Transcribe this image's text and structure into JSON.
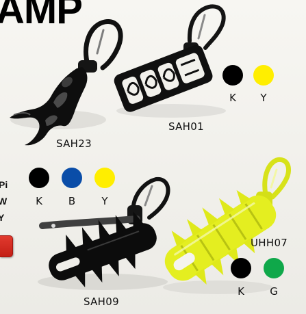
{
  "heading": "AMP",
  "edge_text": [
    "Pi",
    "W",
    "Y"
  ],
  "products": [
    {
      "code": "SAH23",
      "colors": []
    },
    {
      "code": "SAH01",
      "colors": [
        {
          "label": "K",
          "hex": "#000000"
        },
        {
          "label": "Y",
          "hex": "#FFEE00"
        }
      ]
    },
    {
      "code": "SAH09",
      "colors": [
        {
          "label": "K",
          "hex": "#000000"
        },
        {
          "label": "B",
          "hex": "#0A4DA8"
        },
        {
          "label": "Y",
          "hex": "#FFEE00"
        }
      ]
    },
    {
      "code": "UHH07",
      "colors": [
        {
          "label": "K",
          "hex": "#000000"
        },
        {
          "label": "G",
          "hex": "#0FA84A"
        }
      ]
    }
  ]
}
